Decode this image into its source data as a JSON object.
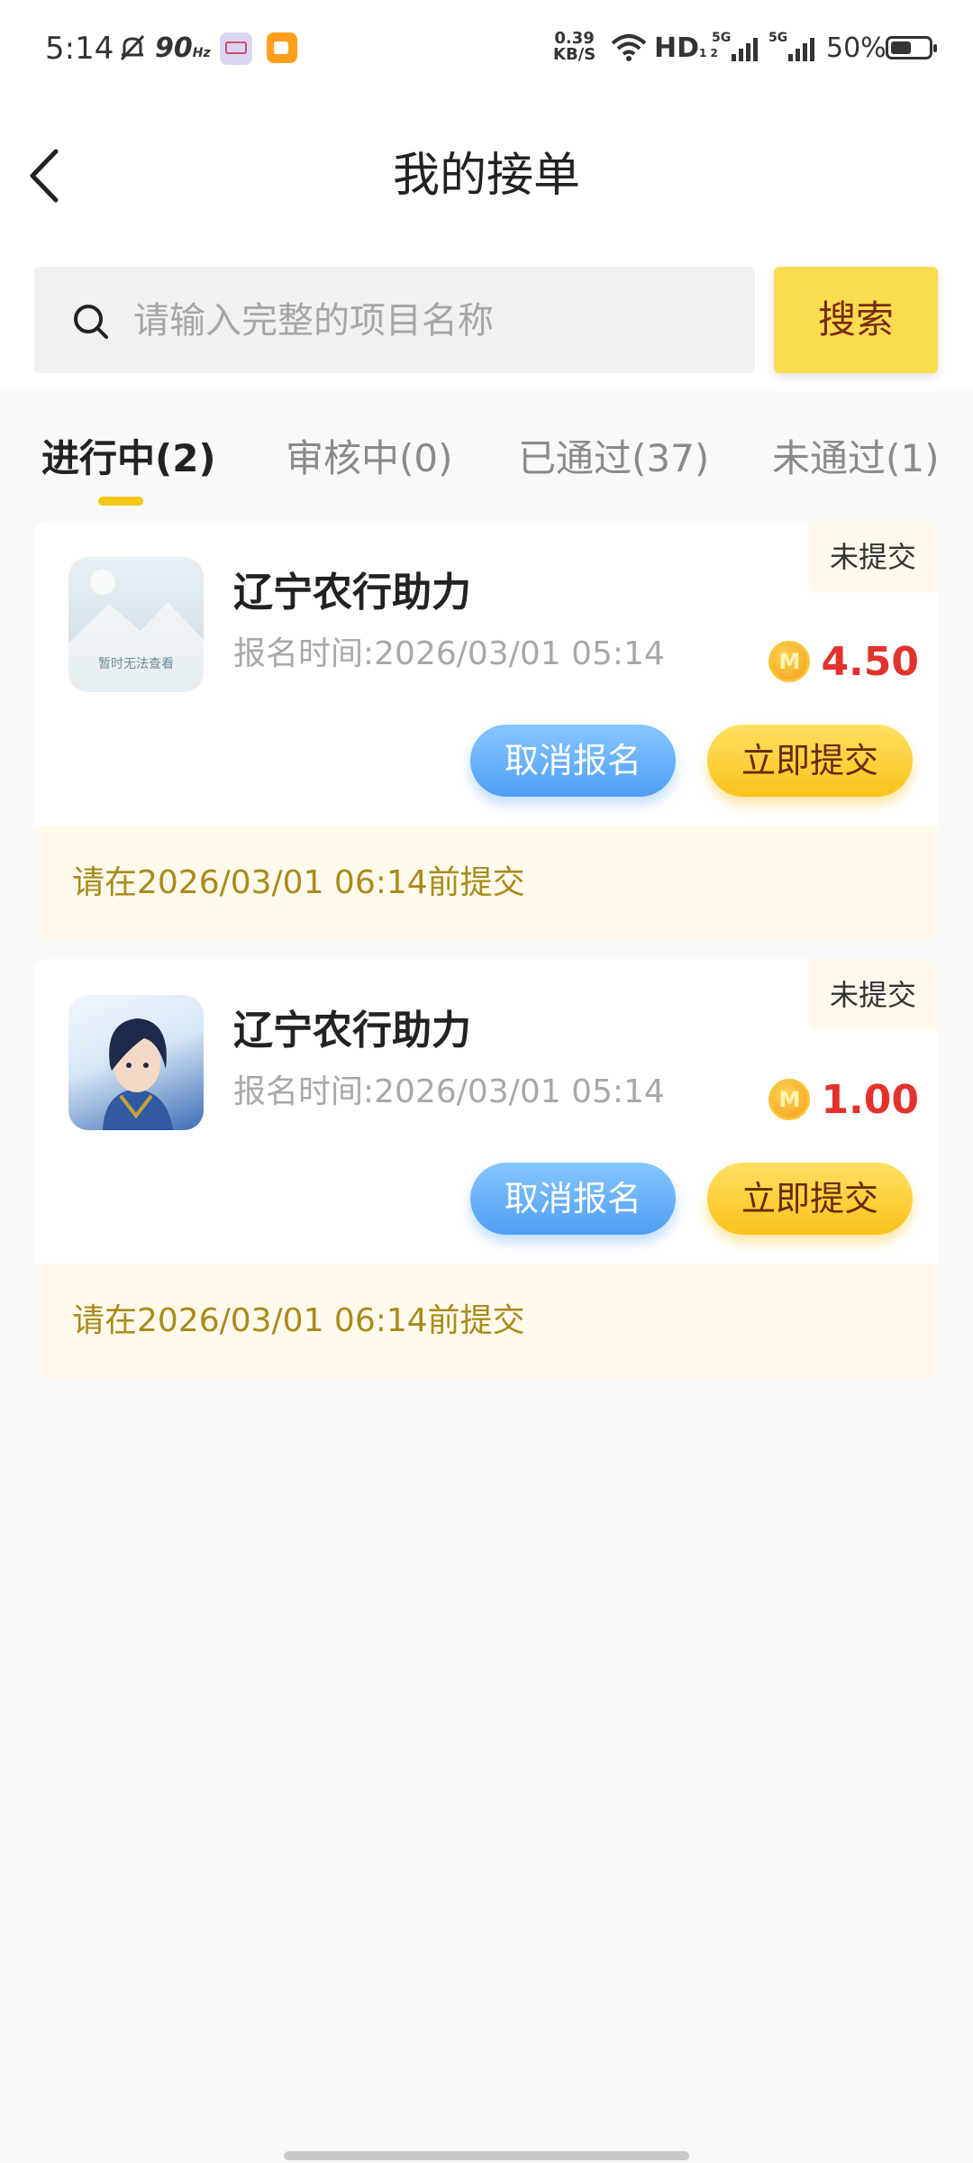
{
  "status_bar": {
    "time": "5:14",
    "refresh_rate": "90",
    "refresh_unit": "Hz",
    "net_speed_value": "0.39",
    "net_speed_unit": "KB/S",
    "hd_label": "HD",
    "hd_sub": "1 2",
    "signal_1": "5G",
    "signal_2": "5G",
    "battery": "50%"
  },
  "header": {
    "title": "我的接单",
    "back_icon": "chevron-left-icon"
  },
  "search": {
    "placeholder": "请输入完整的项目名称",
    "value": "",
    "button_label": "搜索",
    "icon": "search-icon"
  },
  "tabs": [
    {
      "label": "进行中(2)",
      "active": true
    },
    {
      "label": "审核中(0)",
      "active": false
    },
    {
      "label": "已通过(37)",
      "active": false
    },
    {
      "label": "未通过(1)",
      "active": false
    }
  ],
  "orders": [
    {
      "thumb_type": "placeholder",
      "thumb_text": "暂时无法查看",
      "title": "辽宁农行助力",
      "signup_time": "报名时间:2026/03/01 05:14",
      "status": "未提交",
      "coin_symbol": "M",
      "reward": "4.50",
      "cancel_label": "取消报名",
      "submit_label": "立即提交",
      "deadline": "请在2026/03/01 06:14前提交"
    },
    {
      "thumb_type": "avatar",
      "title": "辽宁农行助力",
      "signup_time": "报名时间:2026/03/01 05:14",
      "status": "未提交",
      "coin_symbol": "M",
      "reward": "1.00",
      "cancel_label": "取消报名",
      "submit_label": "立即提交",
      "deadline": "请在2026/03/01 06:14前提交"
    }
  ],
  "colors": {
    "accent_yellow": "#fadc4f",
    "reward_red": "#e3322c",
    "cancel_blue": "#4f9ff5",
    "deadline_text": "#a88b1a"
  }
}
